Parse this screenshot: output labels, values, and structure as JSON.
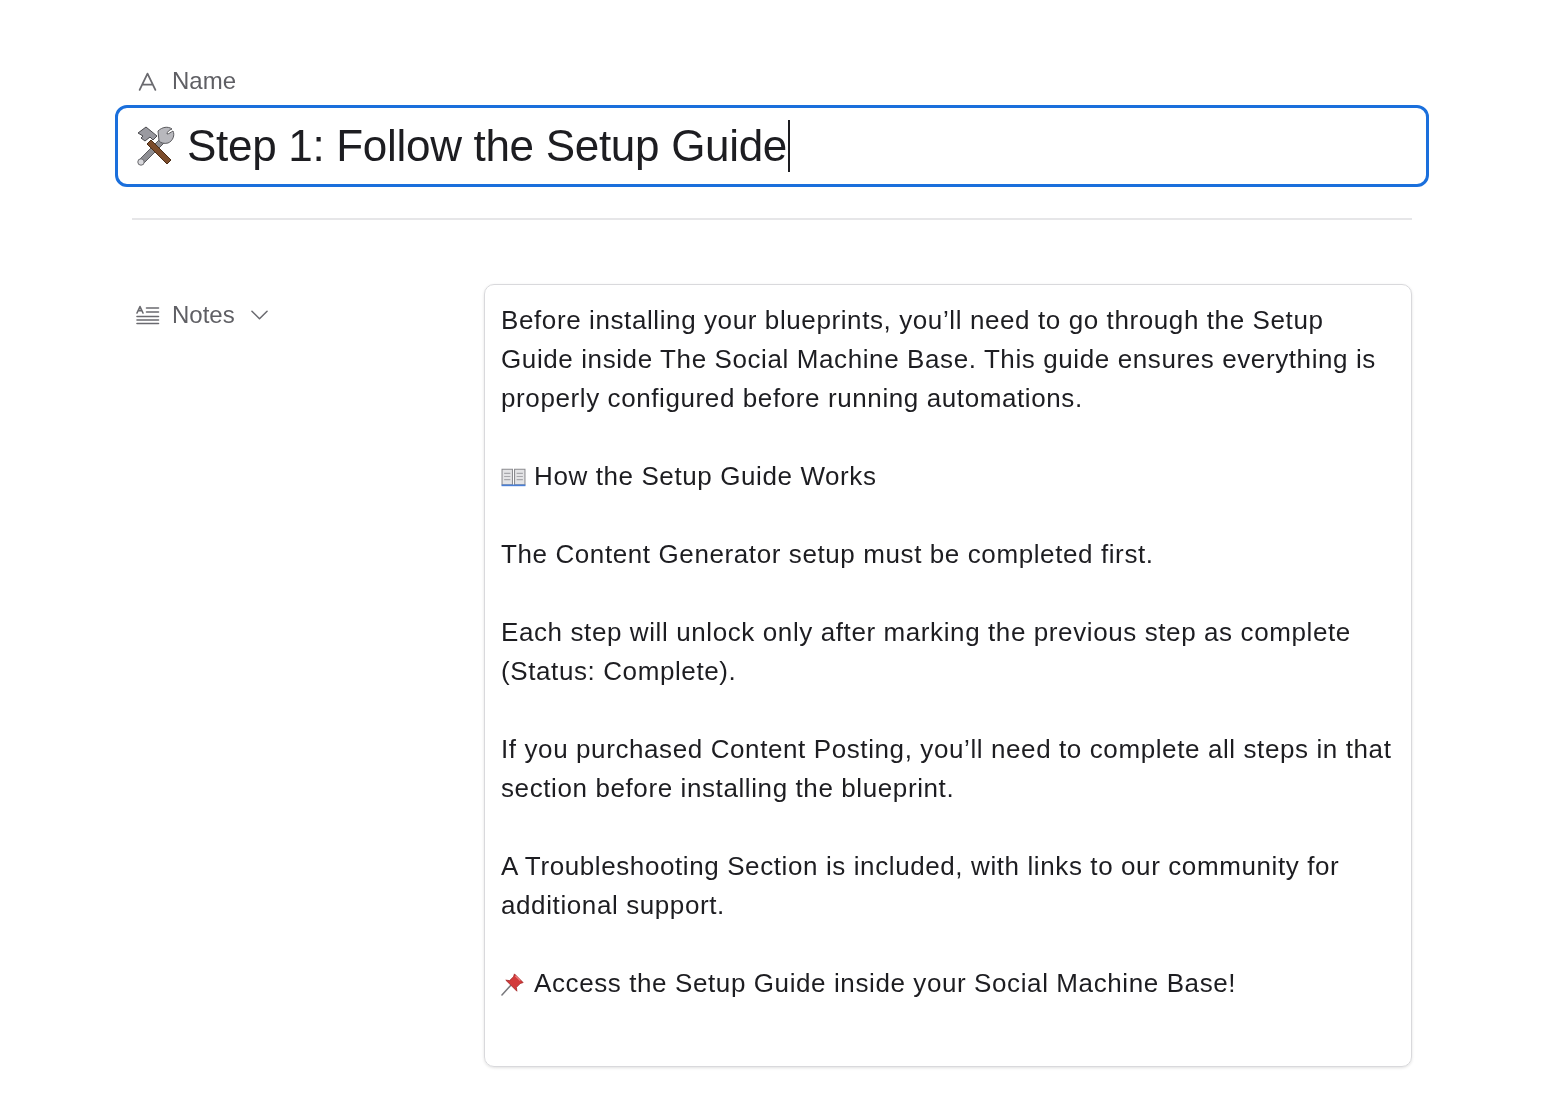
{
  "name_property": {
    "label": "Name",
    "value": "Step 1: Follow the Setup Guide",
    "focused": true
  },
  "notes_property": {
    "label": "Notes",
    "paragraphs": [
      {
        "kind": "text",
        "text": "Before installing your blueprints, you’ll need to go through the Setup Guide inside The Social Machine Base. This guide ensures everything is properly configured before running automations."
      },
      {
        "kind": "book",
        "text": "How the Setup Guide Works"
      },
      {
        "kind": "text",
        "text": "The Content Generator setup must be completed first."
      },
      {
        "kind": "text",
        "text": "Each step will unlock only after marking the previous step as complete (Status: Complete)."
      },
      {
        "kind": "text",
        "text": "If you purchased Content Posting, you’ll need to complete all steps in that section before installing the blueprint."
      },
      {
        "kind": "text",
        "text": "A Troubleshooting Section is included, with links to our community for additional support."
      },
      {
        "kind": "pin",
        "text": "Access the Setup Guide inside your Social Machine Base!"
      }
    ]
  }
}
